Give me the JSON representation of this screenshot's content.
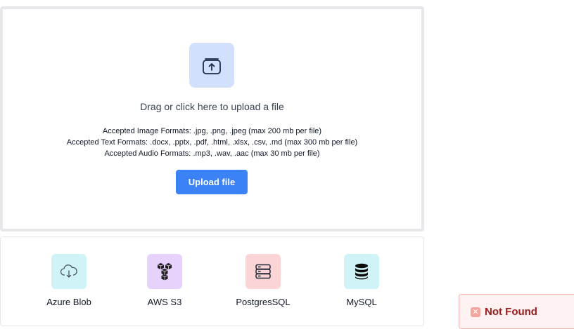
{
  "upload": {
    "icon": "upload-icon",
    "drag_text": "Drag or click here to upload a file",
    "formats": [
      "Accepted Image Formats: .jpg, .png, .jpeg (max 200 mb per file)",
      "Accepted Text Formats: .docx, .pptx, .pdf, .html, .xlsx, .csv, .md (max 300 mb per file)",
      "Accepted Audio Formats: .mp3, .wav, .aac (max 30 mb per file)"
    ],
    "button_label": "Upload file"
  },
  "sources": [
    {
      "label": "Azure Blob",
      "icon": "cloud-download-icon",
      "color": "#cff3f6"
    },
    {
      "label": "AWS S3",
      "icon": "aws-cubes-icon",
      "color": "#e6d2fb"
    },
    {
      "label": "PostgresSQL",
      "icon": "server-stack-icon",
      "color": "#fbd5d5"
    },
    {
      "label": "MySQL",
      "icon": "database-icon",
      "color": "#cff3f6"
    }
  ],
  "toast": {
    "icon": "close-icon",
    "message": "Not Found"
  },
  "colors": {
    "accent": "#3b82f6",
    "upload_icon_bg": "#d3e0fb",
    "toast_bg": "#fdf1f1",
    "toast_text": "#9b1c1c"
  }
}
